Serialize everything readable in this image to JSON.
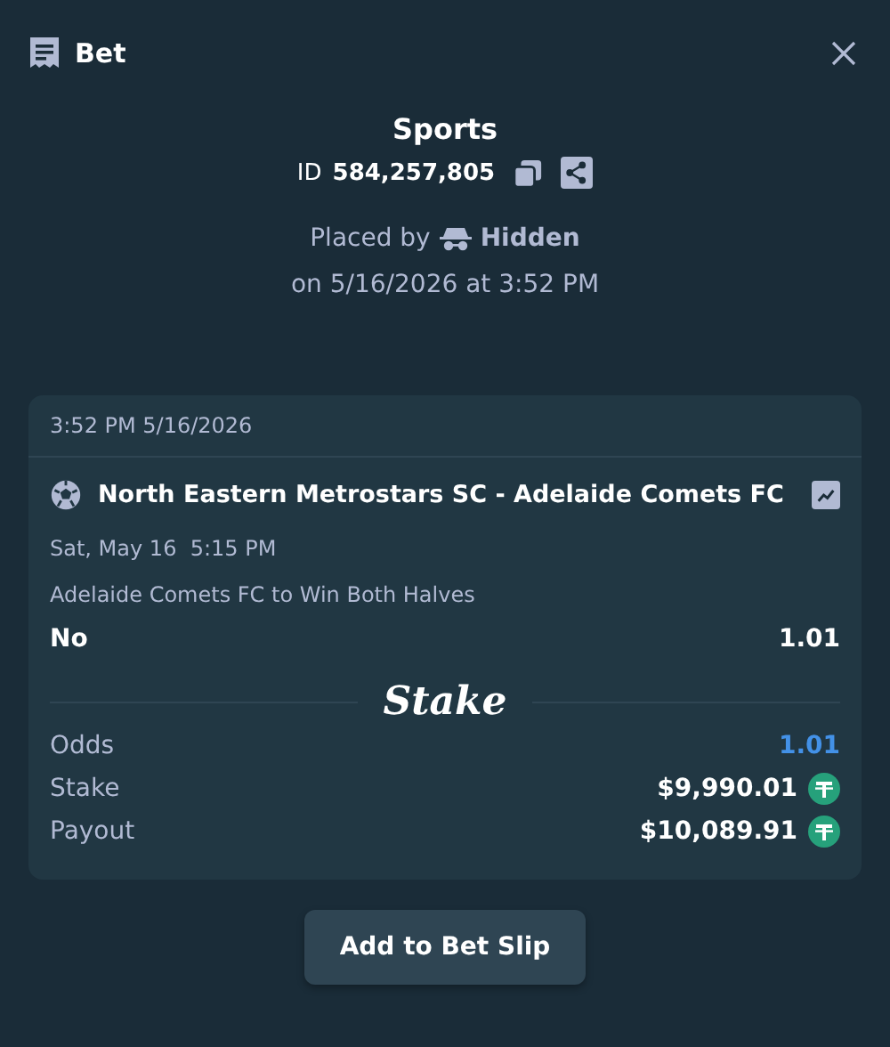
{
  "header": {
    "title": "Bet"
  },
  "summary": {
    "category": "Sports",
    "id_label": "ID",
    "id_value": "584,257,805",
    "placed_by_label": "Placed by",
    "placed_by_user": "Hidden",
    "placed_on": "on 5/16/2026 at 3:52 PM"
  },
  "card": {
    "timestamp": "3:52 PM 5/16/2026",
    "event": "North Eastern Metrostars SC - Adelaide Comets FC",
    "start_time": "Sat, May 16  5:15 PM",
    "market": "Adelaide Comets FC to Win Both Halves",
    "outcome": "No",
    "outcome_odds": "1.01",
    "brand": "Stake",
    "totals": [
      {
        "kind": "odds",
        "label": "Odds",
        "value": "1.01"
      },
      {
        "kind": "amount",
        "label": "Stake",
        "value": "$9,990.01"
      },
      {
        "kind": "amount",
        "label": "Payout",
        "value": "$10,089.91"
      }
    ]
  },
  "button": "Add to Bet Slip"
}
